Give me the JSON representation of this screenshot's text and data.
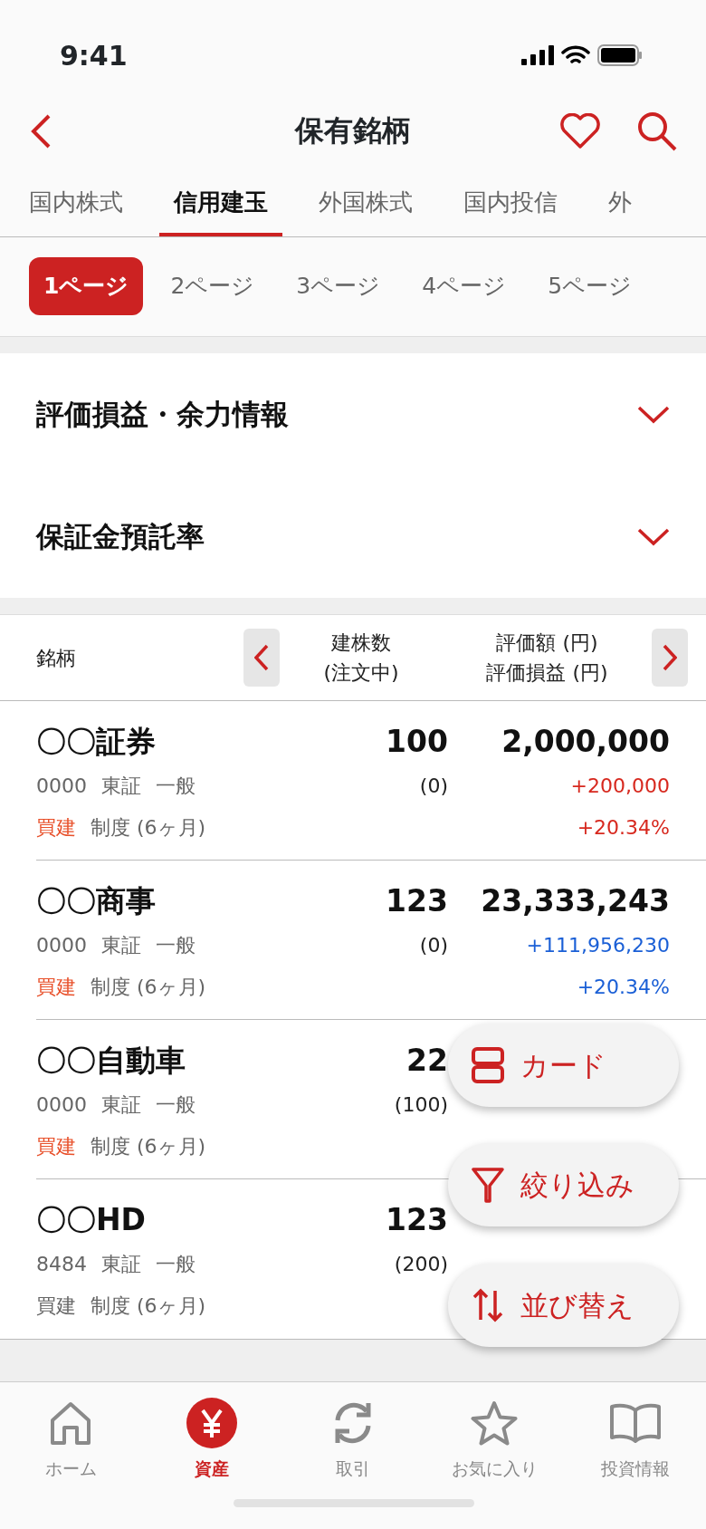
{
  "status_bar": {
    "time": "9:41"
  },
  "header": {
    "title": "保有銘柄"
  },
  "tabs": [
    {
      "label": "国内株式",
      "selected": false
    },
    {
      "label": "信用建玉",
      "selected": true
    },
    {
      "label": "外国株式",
      "selected": false
    },
    {
      "label": "国内投信",
      "selected": false
    },
    {
      "label": "外",
      "selected": false
    }
  ],
  "pages": [
    {
      "label": "1ページ",
      "selected": true
    },
    {
      "label": "2ページ",
      "selected": false
    },
    {
      "label": "3ページ",
      "selected": false
    },
    {
      "label": "4ページ",
      "selected": false
    },
    {
      "label": "5ページ",
      "selected": false
    }
  ],
  "sections": [
    {
      "title": "評価損益・余力情報",
      "expanded": false
    },
    {
      "title": "保証金預託率",
      "expanded": false
    }
  ],
  "table": {
    "columns": [
      "銘柄",
      "建株数",
      "(注文中)",
      "評価額 (円)",
      "評価損益 (円)"
    ],
    "rows": [
      {
        "name": "〇〇証券",
        "code": "0000",
        "market": "東証",
        "account": "一般",
        "side": {
          "text": "買建",
          "color": "#e8502a"
        },
        "term": "制度 (6ヶ月)",
        "shares": "100",
        "pending": "(0)",
        "amount": "2,000,000",
        "pl": {
          "value": "+200,000",
          "rate": "+20.34%",
          "color": "#d7281e"
        }
      },
      {
        "name": "〇〇商事",
        "code": "0000",
        "market": "東証",
        "account": "一般",
        "side": {
          "text": "買建",
          "color": "#e8502a"
        },
        "term": "制度 (6ヶ月)",
        "shares": "123",
        "pending": "(0)",
        "amount": "23,333,243",
        "pl": {
          "value": "+111,956,230",
          "rate": "+20.34%",
          "color": "#1a5fd6"
        }
      },
      {
        "name": "〇〇自動車",
        "code": "0000",
        "market": "東証",
        "account": "一般",
        "side": {
          "text": "買建",
          "color": "#e8502a"
        },
        "term": "制度 (6ヶ月)",
        "shares": "22",
        "pending": "(100)"
      },
      {
        "name": "〇〇HD",
        "code": "8484",
        "market": "東証",
        "account": "一般",
        "side": {
          "text": "買建",
          "color": "#666666"
        },
        "term": "制度 (6ヶ月)",
        "shares": "123",
        "pending": "(200)"
      }
    ]
  },
  "floating_buttons": [
    {
      "kind": "card",
      "label": "カード"
    },
    {
      "kind": "filter",
      "label": "絞り込み"
    },
    {
      "kind": "sort",
      "label": "並び替え"
    }
  ],
  "bottom_nav": [
    {
      "kind": "home",
      "label": "ホーム",
      "selected": false
    },
    {
      "kind": "yen",
      "label": "資産",
      "selected": true
    },
    {
      "kind": "trade",
      "label": "取引",
      "selected": false
    },
    {
      "kind": "star",
      "label": "お気に入り",
      "selected": false
    },
    {
      "kind": "book",
      "label": "投資情報",
      "selected": false
    }
  ]
}
